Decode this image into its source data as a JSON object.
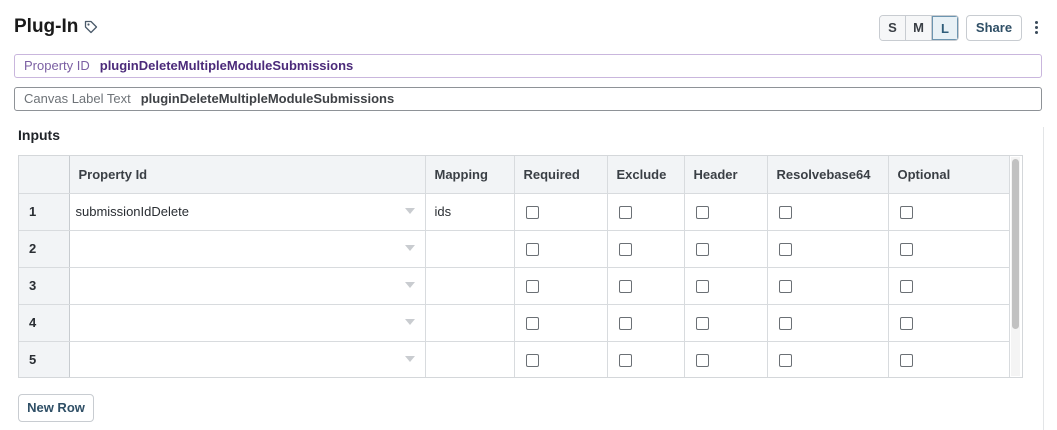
{
  "header": {
    "title": "Plug-In",
    "tag_icon": "tag-icon",
    "sizes": [
      "S",
      "M",
      "L"
    ],
    "active_size": "L",
    "share_label": "Share",
    "menu_icon": "kebab-icon"
  },
  "fields": {
    "property_id": {
      "label": "Property ID",
      "value": "pluginDeleteMultipleModuleSubmissions"
    },
    "canvas_label": {
      "label": "Canvas Label Text",
      "value": "pluginDeleteMultipleModuleSubmissions"
    }
  },
  "inputs": {
    "section_label": "Inputs",
    "columns": [
      "Property Id",
      "Mapping",
      "Required",
      "Exclude",
      "Header",
      "Resolvebase64",
      "Optional"
    ],
    "rows": [
      {
        "num": "1",
        "property_id": "submissionIdDelete",
        "mapping": "ids",
        "required": false,
        "exclude": false,
        "header": false,
        "resolvebase64": false,
        "optional": false
      },
      {
        "num": "2",
        "property_id": "",
        "mapping": "",
        "required": false,
        "exclude": false,
        "header": false,
        "resolvebase64": false,
        "optional": false
      },
      {
        "num": "3",
        "property_id": "",
        "mapping": "",
        "required": false,
        "exclude": false,
        "header": false,
        "resolvebase64": false,
        "optional": false
      },
      {
        "num": "4",
        "property_id": "",
        "mapping": "",
        "required": false,
        "exclude": false,
        "header": false,
        "resolvebase64": false,
        "optional": false
      },
      {
        "num": "5",
        "property_id": "",
        "mapping": "",
        "required": false,
        "exclude": false,
        "header": false,
        "resolvebase64": false,
        "optional": false
      }
    ],
    "new_row_label": "New Row"
  },
  "colors": {
    "accent_purple": "#4b2a7a",
    "button_text": "#2f4f66",
    "active_size_border": "#6c95b0"
  }
}
